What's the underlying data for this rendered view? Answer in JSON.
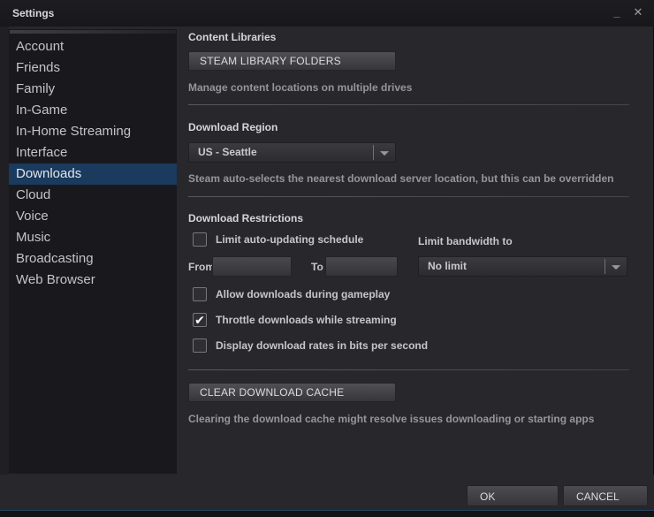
{
  "window": {
    "title": "Settings"
  },
  "icons": {
    "minimize": "_",
    "close": "✕",
    "chevron_down": "▾",
    "check": "✔"
  },
  "sidebar": {
    "items": [
      "Account",
      "Friends",
      "Family",
      "In-Game",
      "In-Home Streaming",
      "Interface",
      "Downloads",
      "Cloud",
      "Voice",
      "Music",
      "Broadcasting",
      "Web Browser"
    ],
    "selected_index": 6
  },
  "content": {
    "content_libraries": {
      "heading": "Content Libraries",
      "steam_library_folders_button": "STEAM LIBRARY FOLDERS",
      "description": "Manage content locations on multiple drives"
    },
    "download_region": {
      "heading": "Download Region",
      "selected_region": "US - Seattle",
      "description": "Steam auto-selects the nearest download server location, but this can be overridden"
    },
    "download_restrictions": {
      "heading": "Download Restrictions",
      "limit_schedule": {
        "label": "Limit auto-updating schedule",
        "checked": false
      },
      "schedule_from": {
        "label": "From",
        "value": ""
      },
      "schedule_to": {
        "label": "To",
        "value": ""
      },
      "bandwidth": {
        "label": "Limit bandwidth to",
        "selected": "No limit"
      },
      "allow_during_gameplay": {
        "label": "Allow downloads during gameplay",
        "checked": false
      },
      "throttle_while_streaming": {
        "label": "Throttle downloads while streaming",
        "checked": true
      },
      "display_rates_bits": {
        "label": "Display download rates in bits per second",
        "checked": false
      }
    },
    "download_cache": {
      "clear_cache_button": "CLEAR DOWNLOAD CACHE",
      "description": "Clearing the download cache might resolve issues downloading or starting apps"
    }
  },
  "footer": {
    "ok_button": "OK",
    "cancel_button": "CANCEL"
  },
  "colors": {
    "selected_item_bg": "#1a3a5e",
    "window_bg": "#28282c",
    "sidebar_bg": "#19191d",
    "titlebar_bg": "#1a1a1e"
  }
}
